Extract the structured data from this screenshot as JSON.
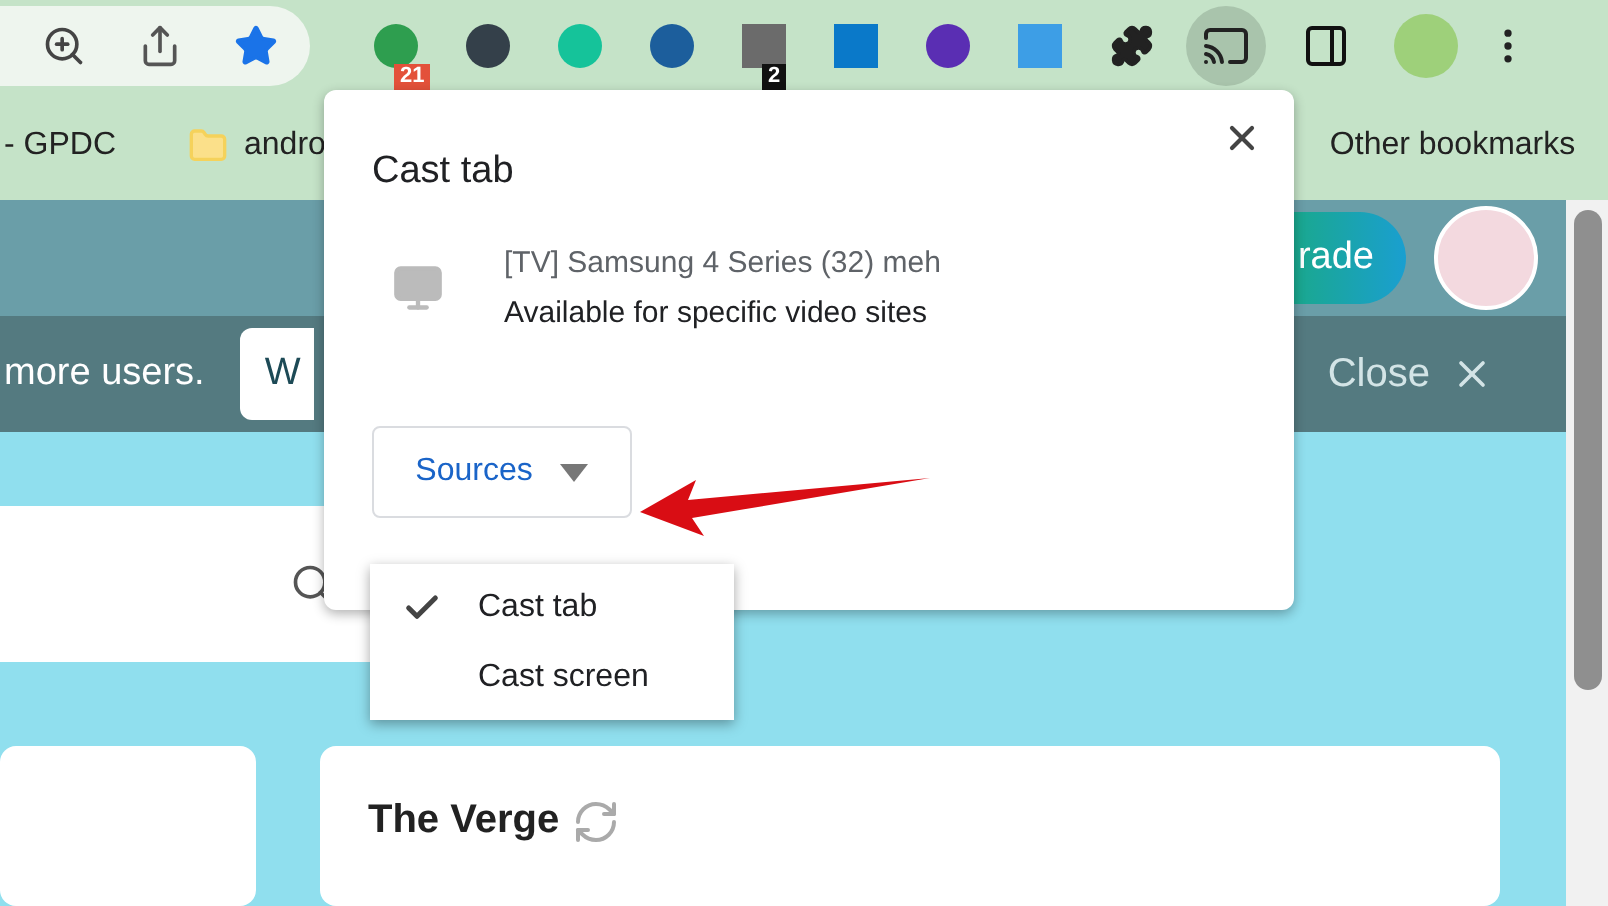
{
  "toolbar": {
    "extension_badges": [
      "21",
      "2"
    ],
    "cast_button": {
      "selected": true
    }
  },
  "bookmarks": [
    {
      "label": "- GPDC",
      "kind": "page"
    },
    {
      "label": "andro",
      "kind": "folder"
    },
    {
      "label": "Other bookmarks",
      "kind": "page"
    }
  ],
  "page": {
    "upgrade_button": "rade",
    "banner": {
      "text": "more users.",
      "button": "W",
      "close": "Close"
    },
    "cards": [
      {
        "title": "The Verge"
      }
    ]
  },
  "cast_dialog": {
    "title": "Cast tab",
    "device": {
      "name": "[TV] Samsung 4 Series (32) meh",
      "status": "Available for specific video sites"
    },
    "sources_button": "Sources",
    "sources_menu": [
      {
        "label": "Cast tab",
        "selected": true
      },
      {
        "label": "Cast screen",
        "selected": false
      }
    ]
  }
}
